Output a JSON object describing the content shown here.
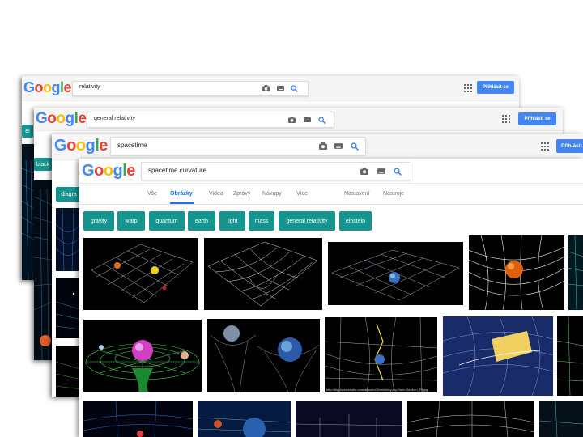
{
  "logo": [
    "G",
    "o",
    "o",
    "g",
    "l",
    "e"
  ],
  "screen1": {
    "query": "relativity",
    "signin": "Přihlásit se"
  },
  "screen2": {
    "query": "general relativity",
    "signin": "Přihlásit se"
  },
  "screen3": {
    "query": "spacetime",
    "signin": "Přihlásit"
  },
  "screen4": {
    "query": "spacetime curvature",
    "tabs": [
      "Vše",
      "Obrázky",
      "Videa",
      "Zprávy",
      "Nákupy",
      "Více",
      "Nastavení",
      "Nástroje"
    ],
    "active_tab": "Obrázky",
    "chips": [
      "gravity",
      "warp",
      "quantum",
      "earth",
      "light",
      "mass",
      "general relativity",
      "einstein"
    ],
    "caption": "http://bigphysicstudio.com/about/c05/relativity.asp?sub=3wMcrn_Plgpg"
  },
  "partial_chips": {
    "s1": "ei",
    "s2": "black",
    "s3": "diagra"
  },
  "colors": {
    "chip": "#169590",
    "accent": "#4285f4"
  }
}
